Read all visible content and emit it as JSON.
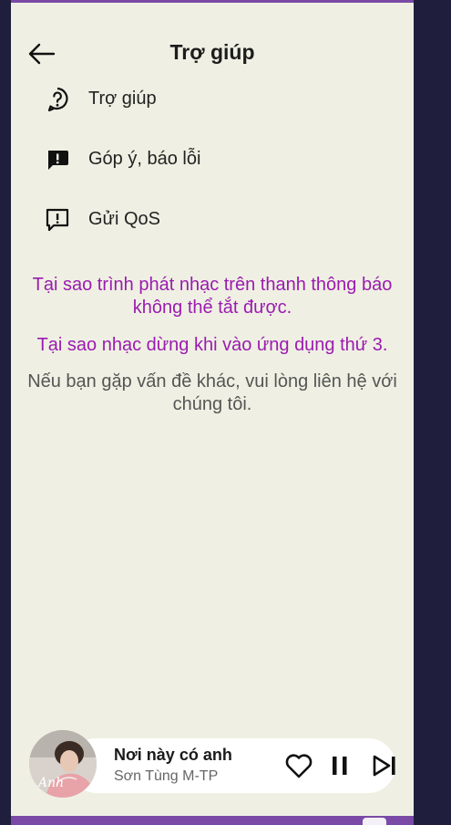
{
  "header": {
    "title": "Trợ giúp",
    "back_icon": "arrow-back-icon"
  },
  "menu": [
    {
      "label": "Trợ giúp",
      "icon": "help-circle-icon"
    },
    {
      "label": "Góp ý, báo lỗi",
      "icon": "feedback-icon"
    },
    {
      "label": "Gửi QoS",
      "icon": "report-chat-icon"
    }
  ],
  "faq": [
    {
      "text": "Tại sao trình phát nhạc trên thanh thông báo không thể tắt được."
    },
    {
      "text": "Tại sao nhạc dừng khi vào ứng dụng thứ 3."
    }
  ],
  "note": "Nếu bạn gặp vấn đề khác, vui lòng liên hệ với chúng tôi.",
  "player": {
    "song": "Nơi này có anh",
    "artist": "Sơn Tùng M-TP",
    "cover_caption": "Anh"
  },
  "colors": {
    "accent": "#9b1bb0",
    "frame": "#7b4aa6",
    "background": "#eff0e3"
  }
}
